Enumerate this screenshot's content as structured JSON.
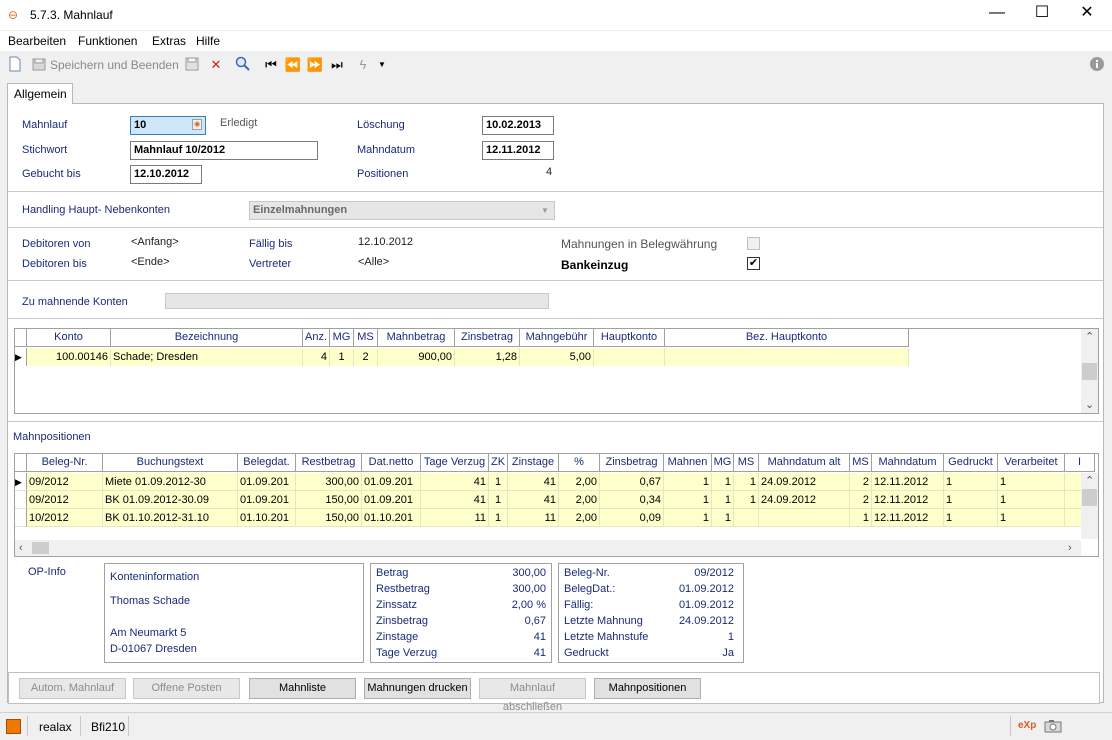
{
  "window": {
    "title": "5.7.3. Mahnlauf",
    "minimize": "—",
    "maximize": "☐",
    "close": "✕"
  },
  "menu": [
    "Bearbeiten",
    "Funktionen",
    "Extras",
    "Hilfe"
  ],
  "toolbar": {
    "save_close": "Speichern und Beenden"
  },
  "tab": "Allgemein",
  "form": {
    "mahnlauf_label": "Mahnlauf",
    "mahnlauf_value": "10",
    "erledigt": "Erledigt",
    "stichwort_label": "Stichwort",
    "stichwort_value": "Mahnlauf 10/2012",
    "gebucht_label": "Gebucht bis",
    "gebucht_value": "12.10.2012",
    "loeschung_label": "Löschung",
    "loeschung_value": "10.02.2013",
    "mahndatum_label": "Mahndatum",
    "mahndatum_value": "12.11.2012",
    "positionen_label": "Positionen",
    "positionen_value": "4",
    "handling_label": "Handling Haupt- Nebenkonten",
    "handling_value": "Einzelmahnungen",
    "debvon_label": "Debitoren von",
    "debvon_value": "<Anfang>",
    "debbis_label": "Debitoren bis",
    "debbis_value": "<Ende>",
    "faellig_label": "Fällig bis",
    "faellig_value": "12.10.2012",
    "vertreter_label": "Vertreter",
    "vertreter_value": "<Alle>",
    "belegwaehrung_label": "Mahnungen in Belegwährung",
    "belegwaehrung_checked": false,
    "bankeinzug_label": "Bankeinzug",
    "bankeinzug_checked": true,
    "konten_label": "Zu mahnende Konten"
  },
  "accounts_grid": {
    "headers": [
      "Konto",
      "Bezeichnung",
      "Anz.",
      "MG",
      "MS",
      "Mahnbetrag",
      "Zinsbetrag",
      "Mahngebühr",
      "Hauptkonto",
      "Bez. Hauptkonto"
    ],
    "rows": [
      [
        "100.00146",
        "Schade; Dresden",
        "4",
        "1",
        "2",
        "900,00",
        "1,28",
        "5,00",
        "",
        ""
      ]
    ]
  },
  "mahnpositionen_label": "Mahnpositionen",
  "positions_grid": {
    "headers": [
      "Beleg-Nr.",
      "Buchungstext",
      "Belegdat.",
      "Restbetrag",
      "Dat.netto",
      "Tage Verzug",
      "ZK",
      "Zinstage",
      "%",
      "Zinsbetrag",
      "Mahnen",
      "MG",
      "MS",
      "Mahndatum alt",
      "MS",
      "Mahndatum",
      "Gedruckt",
      "Verarbeitet",
      "I"
    ],
    "rows": [
      [
        "09/2012",
        "Miete 01.09.2012-30",
        "01.09.201",
        "300,00",
        "01.09.201",
        "41",
        "1",
        "41",
        "2,00",
        "0,67",
        "1",
        "1",
        "1",
        "24.09.2012",
        "2",
        "12.11.2012",
        "1",
        "1"
      ],
      [
        "09/2012",
        "BK 01.09.2012-30.09",
        "01.09.201",
        "150,00",
        "01.09.201",
        "41",
        "1",
        "41",
        "2,00",
        "0,34",
        "1",
        "1",
        "1",
        "24.09.2012",
        "2",
        "12.11.2012",
        "1",
        "1"
      ],
      [
        "10/2012",
        "BK 01.10.2012-31.10",
        "01.10.201",
        "150,00",
        "01.10.201",
        "11",
        "1",
        "11",
        "2,00",
        "0,09",
        "1",
        "1",
        "",
        "",
        "1",
        "12.11.2012",
        "1",
        "1"
      ]
    ]
  },
  "op_info": {
    "label": "OP-Info",
    "konto": {
      "heading": "Konteninformation",
      "name": "Thomas Schade",
      "street": "Am Neumarkt 5",
      "city": "D-01067 Dresden"
    },
    "betrag": [
      {
        "label": "Betrag",
        "value": "300,00"
      },
      {
        "label": "Restbetrag",
        "value": "300,00"
      },
      {
        "label": "Zinssatz",
        "value": "2,00 %"
      },
      {
        "label": "Zinsbetrag",
        "value": "0,67"
      },
      {
        "label": "Zinstage",
        "value": "41"
      },
      {
        "label": "Tage Verzug",
        "value": "41"
      }
    ],
    "beleg": [
      {
        "label": "Beleg-Nr.",
        "value": "09/2012"
      },
      {
        "label": "BelegDat.:",
        "value": "01.09.2012"
      },
      {
        "label": "Fällig:",
        "value": "01.09.2012"
      },
      {
        "label": "Letzte Mahnung",
        "value": "24.09.2012"
      },
      {
        "label": "Letzte Mahnstufe",
        "value": "1"
      },
      {
        "label": "Gedruckt",
        "value": "Ja"
      }
    ]
  },
  "buttons": [
    "Autom. Mahnlauf",
    "Offene Posten",
    "Mahnliste",
    "Mahnungen drucken",
    "Mahnlauf abschließen",
    "Mahnpositionen"
  ],
  "status": {
    "user": "realax",
    "module": "Bfi210"
  },
  "colors": {
    "row_highlight": "#ffffcc",
    "label_blue": "#1a2a7a",
    "status_orange": "#f07800"
  }
}
